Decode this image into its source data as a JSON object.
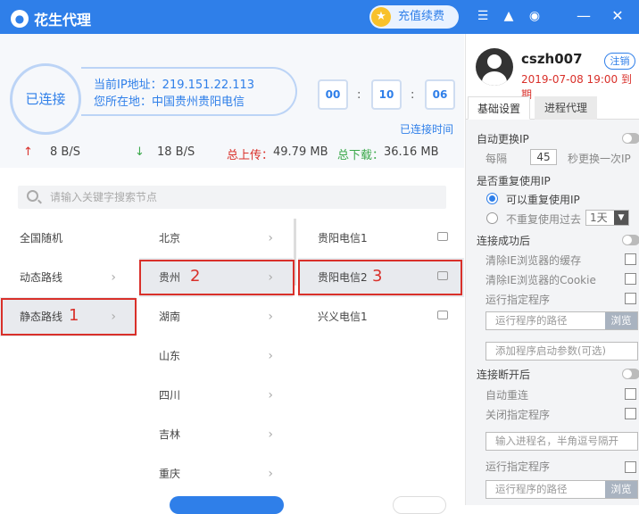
{
  "app": {
    "title": "花生代理",
    "recharge_label": "充值续费"
  },
  "status": {
    "connected_label": "已连接",
    "ip_line": "当前IP地址：219.151.22.113",
    "location_line": "您所在地：中国贵州贵阳电信",
    "time_h": "00",
    "time_m": "10",
    "time_s": "06",
    "connected_time_label": "已连接时间",
    "upload_speed": "8 B/S",
    "download_speed": "18 B/S",
    "total_upload_label": "总上传：",
    "total_upload_value": "49.79 MB",
    "total_download_label": "总下载：",
    "total_download_value": "36.16 MB"
  },
  "search": {
    "placeholder": "请输入关键字搜索节点"
  },
  "modes": [
    "全国随机",
    "动态路线",
    "静态路线"
  ],
  "provinces": [
    "北京",
    "贵州",
    "湖南",
    "山东",
    "四川",
    "吉林",
    "重庆"
  ],
  "nodes": [
    "贵阳电信1",
    "贵阳电信2",
    "兴义电信1"
  ],
  "annotations": [
    "1",
    "2",
    "3"
  ],
  "user": {
    "name": "cszh007",
    "logout_label": "注销",
    "expire_date": "2019-07-08 19:00",
    "expire_suffix": "到期"
  },
  "tabs": [
    "基础设置",
    "进程代理"
  ],
  "settings": {
    "auto_change_ip": "自动更换IP",
    "every": "每隔",
    "interval": "45",
    "interval_suffix": "秒更换一次IP",
    "reuse_ip": "是否重复使用IP",
    "reuse_yes": "可以重复使用IP",
    "reuse_no": "不重复使用过去",
    "days_value": "1天",
    "after_connect": "连接成功后",
    "clear_cache": "清除IE浏览器的缓存",
    "clear_cookie": "清除IE浏览器的Cookie",
    "run_program": "运行指定程序",
    "program_path_placeholder": "运行程序的路径",
    "browse": "浏览",
    "startup_args_placeholder": "添加程序启动参数(可选)",
    "after_disconnect": "连接断开后",
    "auto_reconnect": "自动重连",
    "close_program": "关闭指定程序",
    "process_name_placeholder": "输入进程名，半角逗号隔开",
    "run_program_2": "运行指定程序",
    "program_path_placeholder_2": "运行程序的路径",
    "browse_2": "浏览"
  }
}
